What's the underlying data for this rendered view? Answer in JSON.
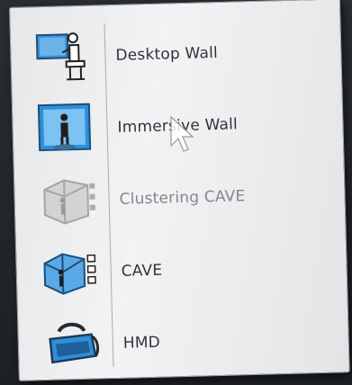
{
  "menu": {
    "items": [
      {
        "label": "Desktop Wall",
        "icon": "desktop-wall-icon",
        "enabled": true
      },
      {
        "label": "Immersive Wall",
        "icon": "immersive-wall-icon",
        "enabled": true
      },
      {
        "label": "Clustering CAVE",
        "icon": "clustering-cave-icon",
        "enabled": false
      },
      {
        "label": "CAVE",
        "icon": "cave-icon",
        "enabled": true
      },
      {
        "label": "HMD",
        "icon": "hmd-icon",
        "enabled": true
      }
    ]
  },
  "colors": {
    "menu_background": "#eeeff1",
    "text": "#2f3338",
    "disabled_text": "#82868b",
    "icon_blue": "#2f8fd8"
  }
}
